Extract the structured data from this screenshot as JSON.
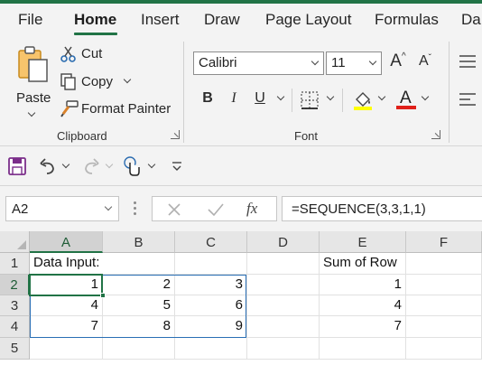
{
  "colors": {
    "accent": "#217346",
    "selection_border": "#2a6fb5",
    "highlight_yellow": "#ffff00",
    "font_red": "#e0201a"
  },
  "tabs": [
    "File",
    "Home",
    "Insert",
    "Draw",
    "Page Layout",
    "Formulas",
    "Da"
  ],
  "active_tab": "Home",
  "clipboard": {
    "paste_label": "Paste",
    "cut_label": "Cut",
    "copy_label": "Copy",
    "format_painter_label": "Format Painter",
    "group_label": "Clipboard"
  },
  "font": {
    "family": "Calibri",
    "size": "11",
    "bold": "B",
    "italic": "I",
    "underline": "U",
    "group_label": "Font"
  },
  "icons": {
    "paste": "paste-icon",
    "cut": "scissors-icon",
    "copy": "copy-icon",
    "format_painter": "paintbrush-icon",
    "grow": "increase-font-icon",
    "shrink": "decrease-font-icon",
    "borders": "borders-icon",
    "fill": "fill-color-icon",
    "font_color": "font-color-icon",
    "save": "save-icon",
    "undo": "undo-icon",
    "redo": "redo-icon",
    "touch": "touch-mode-icon",
    "customize": "customize-qat-icon",
    "cancel": "cancel-x-icon",
    "enter": "enter-check-icon",
    "insert_function": "insert-function-icon"
  },
  "formula_bar": {
    "name_box": "A2",
    "fx_label": "fx",
    "formula": "=SEQUENCE(3,3,1,1)"
  },
  "grid": {
    "columns": [
      "A",
      "B",
      "C",
      "D",
      "E",
      "F"
    ],
    "rows": [
      "1",
      "2",
      "3",
      "4",
      "5"
    ],
    "a1": "Data Input:",
    "e1": "Sum of Row",
    "data": [
      [
        "1",
        "2",
        "3"
      ],
      [
        "4",
        "5",
        "6"
      ],
      [
        "7",
        "8",
        "9"
      ]
    ],
    "row_sums": [
      "1",
      "4",
      "7"
    ]
  }
}
